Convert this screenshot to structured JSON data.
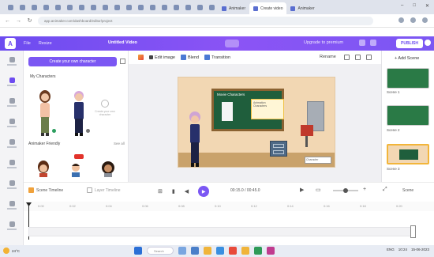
{
  "browser": {
    "tabs": [
      {
        "label": "Animaker",
        "active": false
      },
      {
        "label": "Create video",
        "active": true
      },
      {
        "label": "Animaker",
        "active": false
      }
    ],
    "url": "app.animaker.com/dashboard/editor/project",
    "window_controls": [
      "–",
      "□",
      "✕"
    ]
  },
  "app_header": {
    "logo": "A",
    "menu_file": "File",
    "menu_resize": "Resize",
    "project_title": "Untitled Video",
    "upgrade_text": "Upgrade to premium",
    "publish_label": "PUBLISH"
  },
  "left_rail": {
    "items": [
      "Templates",
      "Characters",
      "Properties",
      "BG",
      "Text",
      "Music",
      "Effects",
      "Upload",
      "More"
    ]
  },
  "side_panel": {
    "create_button": "Create your own character",
    "section_my_characters": "My Characters",
    "placeholder_text": "Create your own character",
    "section_popular": "Animaker Friendly",
    "see_all": "See all"
  },
  "toolbar": {
    "edit_image": "Edit image",
    "blend": "Blend",
    "transition": "Transition",
    "rename": "Rename"
  },
  "scene": {
    "board_title": "Movie Characters",
    "note_line1": "Animation",
    "note_line2": "Characters",
    "tag_text": "Character"
  },
  "right_panel": {
    "add_scene": "+ Add Scene",
    "scenes": [
      "Scene 1",
      "Scene 2",
      "Scene 3"
    ]
  },
  "timeline": {
    "scene_timeline": "Scene Timeline",
    "layer_timeline": "Layer Timeline",
    "time": "00:15.0 / 00:45.0",
    "zoom_label": "Scene",
    "ruler_ticks": [
      "0:00",
      "0:02",
      "0:04",
      "0:06",
      "0:08",
      "0:10",
      "0:12",
      "0:14",
      "0:16",
      "0:18",
      "0:20"
    ]
  },
  "taskbar": {
    "weather": "24°C",
    "weather_sub": "Sunny",
    "search_placeholder": "Search",
    "time": "10:24",
    "date": "15-06-2023",
    "lang": "ENG"
  },
  "colors": {
    "accent": "#7b57f3",
    "board_green": "#1f5e3c",
    "wall": "#f2d7b3"
  }
}
